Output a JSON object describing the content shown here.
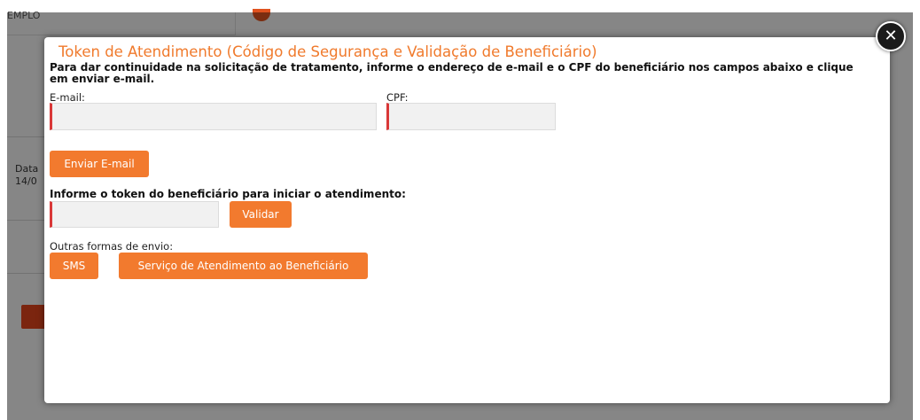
{
  "background": {
    "field_text": "EMPLO",
    "side_label_1": "Data",
    "side_label_2": "14/0"
  },
  "modal": {
    "title": "Token de Atendimento (Código de Segurança e Validação de Beneficiário)",
    "intro": "Para dar continuidade na solicitação de tratamento, informe o endereço de e-mail e o CPF do beneficiário nos campos abaixo e clique em enviar e-mail.",
    "email_label": "E-mail:",
    "email_value": "",
    "cpf_label": "CPF:",
    "cpf_value": "",
    "send_email_button": "Enviar E-mail",
    "token_label": "Informe o token do beneficiário para iniciar o atendimento:",
    "token_value": "",
    "validate_button": "Validar",
    "other_methods_label": "Outras formas de envio:",
    "sms_button": "SMS",
    "service_button": "Serviço de Atendimento ao Beneficiário",
    "close_icon": "close-icon"
  },
  "colors": {
    "accent": "#f27a2e",
    "title": "#f07a2c",
    "required_marker": "#d93838"
  }
}
